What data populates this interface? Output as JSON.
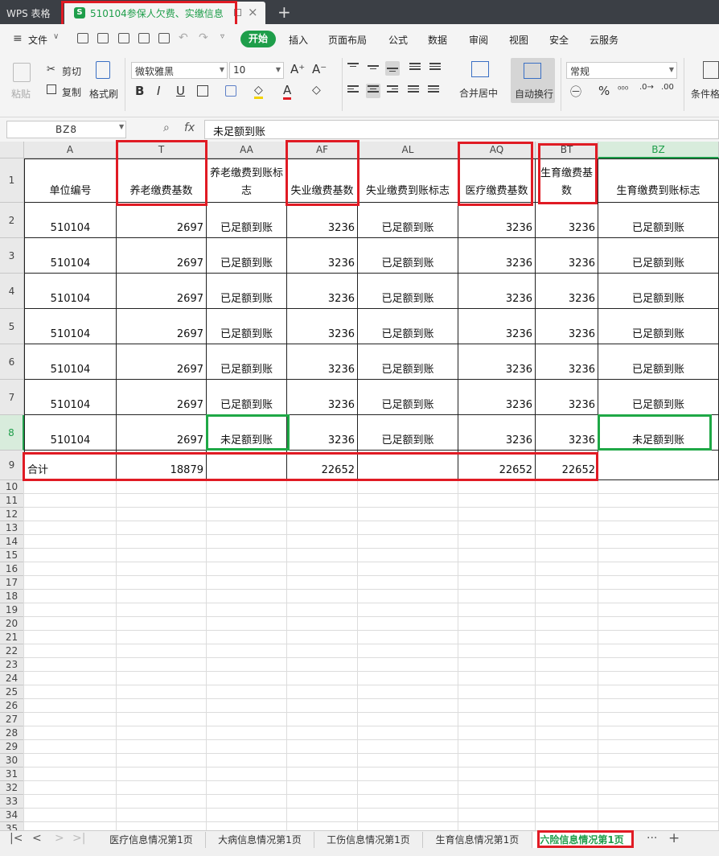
{
  "titlebar": {
    "app_name": "WPS 表格",
    "doc_tab_icon": "S",
    "doc_tab_title": "510104参保人欠费、实缴信息",
    "new_tab": "+",
    "close": "×"
  },
  "menu": {
    "file": "文件",
    "start": "开始",
    "insert": "插入",
    "page_layout": "页面布局",
    "formula": "公式",
    "data": "数据",
    "review": "审阅",
    "view": "视图",
    "security": "安全",
    "cloud": "云服务"
  },
  "ribbon": {
    "paste": "粘贴",
    "cut": "剪切",
    "copy": "复制",
    "format_painter": "格式刷",
    "font_name": "微软雅黑",
    "font_size": "10",
    "number_format": "常规",
    "merge_center": "合并居中",
    "wrap_text": "自动换行",
    "conditional": "条件格"
  },
  "formula_bar": {
    "name_box": "BZ8",
    "fx": "fx",
    "value": "未足额到账"
  },
  "columns": [
    "A",
    "T",
    "AA",
    "AF",
    "AL",
    "AQ",
    "BT",
    "BZ"
  ],
  "selected_column": "BZ",
  "selected_row": "8",
  "table": {
    "headers": [
      "单位编号",
      "养老缴费基数",
      "养老缴费到账标志",
      "失业缴费基数",
      "失业缴费到账标志",
      "医疗缴费基数",
      "生育缴费基数",
      "生育缴费到账标志"
    ],
    "rows": [
      [
        "510104",
        "2697",
        "已足额到账",
        "3236",
        "已足额到账",
        "3236",
        "3236",
        "已足额到账"
      ],
      [
        "510104",
        "2697",
        "已足额到账",
        "3236",
        "已足额到账",
        "3236",
        "3236",
        "已足额到账"
      ],
      [
        "510104",
        "2697",
        "已足额到账",
        "3236",
        "已足额到账",
        "3236",
        "3236",
        "已足额到账"
      ],
      [
        "510104",
        "2697",
        "已足额到账",
        "3236",
        "已足额到账",
        "3236",
        "3236",
        "已足额到账"
      ],
      [
        "510104",
        "2697",
        "已足额到账",
        "3236",
        "已足额到账",
        "3236",
        "3236",
        "已足额到账"
      ],
      [
        "510104",
        "2697",
        "已足额到账",
        "3236",
        "已足额到账",
        "3236",
        "3236",
        "已足额到账"
      ],
      [
        "510104",
        "2697",
        "未足额到账",
        "3236",
        "已足额到账",
        "3236",
        "3236",
        "未足额到账"
      ]
    ],
    "total_row": [
      "合计",
      "18879",
      "",
      "22652",
      "",
      "22652",
      "22652",
      ""
    ]
  },
  "row_numbers": [
    "1",
    "2",
    "3",
    "4",
    "5",
    "6",
    "7",
    "8",
    "9",
    "10",
    "11",
    "12",
    "13",
    "14",
    "15",
    "16",
    "17",
    "18",
    "19",
    "20",
    "21",
    "22",
    "23",
    "24",
    "25",
    "26",
    "27",
    "28",
    "29",
    "30",
    "31",
    "32",
    "33",
    "34",
    "35"
  ],
  "sheets": {
    "tabs": [
      "医疗信息情况第1页",
      "大病信息情况第1页",
      "工伤信息情况第1页",
      "生育信息情况第1页",
      "六险信息情况第1页"
    ],
    "active_index": 4,
    "more": "···",
    "add": "+"
  },
  "colors": {
    "accent": "#1e9e4a",
    "highlight_red": "#e01b24",
    "highlight_green": "#1fa846"
  }
}
